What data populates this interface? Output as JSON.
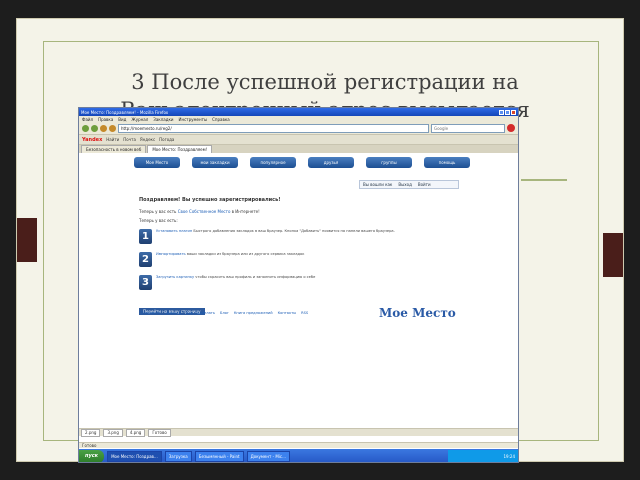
{
  "slide": {
    "title_line1": "3 После успешной регистрации на",
    "title_line2": "Ваш электронный адрес высылается"
  },
  "browser": {
    "window_title": "Мое Место: Поздравляем! - Mozilla Firefox",
    "menu": [
      "Файл",
      "Правка",
      "Вид",
      "Журнал",
      "Закладки",
      "Инструменты",
      "Справка"
    ],
    "url": "http://moemesto.ru/reg2/",
    "search_placeholder": "Google",
    "toolbar2": [
      "Yandex",
      "Найти",
      "Почта",
      "Яндекс",
      "Погода"
    ],
    "tabs": [
      {
        "label": "Безопасность в новом веб",
        "active": false
      },
      {
        "label": "Мое Место: Поздравляем!",
        "active": true
      }
    ],
    "status": "Готово"
  },
  "site": {
    "nav": [
      "Мое Место",
      "мои закладки",
      "популярное",
      "друзья",
      "группы",
      "помощь"
    ],
    "util": [
      "Вы вошли как",
      "Выход",
      "Войти"
    ],
    "congrats": "Поздравляем! Вы успешно зарегистрировались!",
    "now_text": "Теперь у вас есть",
    "now_link": "Свое Собственное Место",
    "now_tail": "в Интернете!",
    "can_text": "Теперь у вас есть:",
    "steps": [
      {
        "num": "1",
        "link": "Установить плагин",
        "text": "Быстрого добавления закладок в ваш браузер. Кнопка \"Добавить\" появится на панели вашего браузера."
      },
      {
        "num": "2",
        "link": "Импортировать",
        "text": "ваши закладки из браузера или из другого сервиса закладок"
      },
      {
        "num": "3",
        "link": "Загрузить картинку",
        "text": "чтобы скрасить ваш профиль и заполнить информацию о себе"
      }
    ],
    "home_button": "Перейти на вашу страницу",
    "footer": [
      "О проекте",
      "Новости",
      "Как Подделать",
      "Блог",
      "Книга предложений",
      "Контакты",
      "RSS"
    ],
    "logo": "Мое Место"
  },
  "downloads": [
    "2.png",
    "3.png",
    "4.png",
    "Готово"
  ],
  "taskbar": {
    "start": "пуск",
    "tasks": [
      "Мое Место: Поздрав...",
      "Загрузка",
      "Безымянный - Paint",
      "Документ - Mic..."
    ],
    "tray": "19:24"
  }
}
